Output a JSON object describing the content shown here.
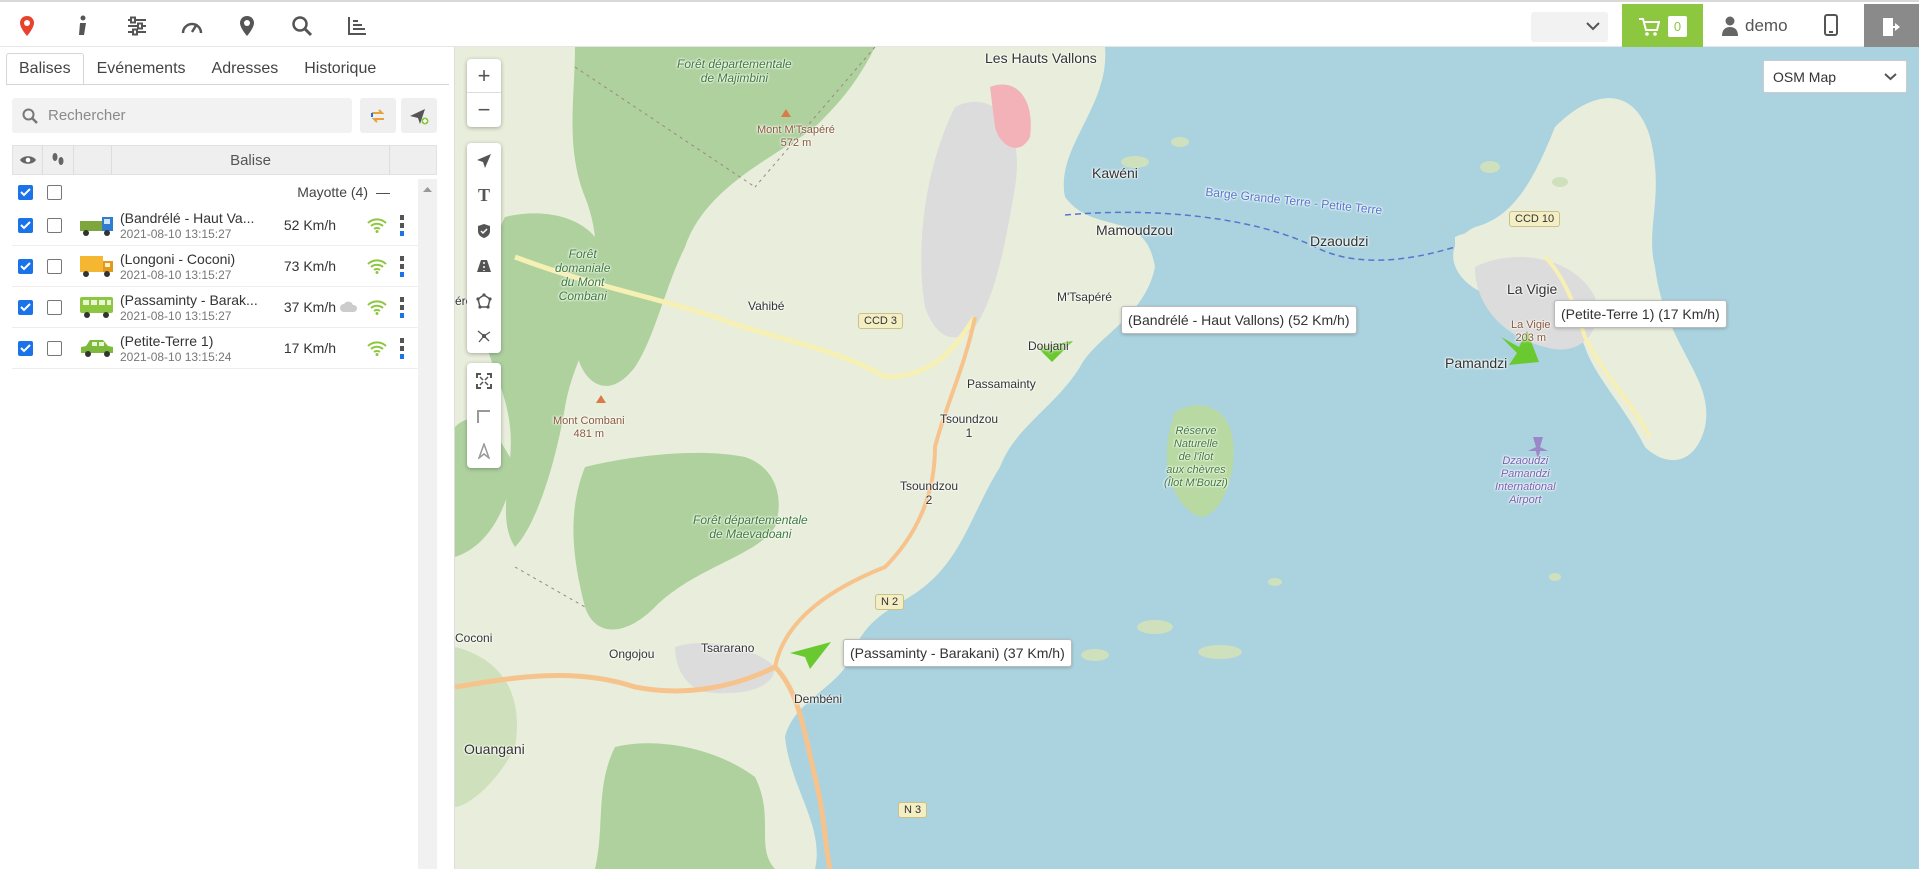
{
  "topbar": {
    "icons": [
      "map-pin-icon",
      "info-icon",
      "sliders-icon",
      "speedometer-icon",
      "location-marker-icon",
      "search-icon",
      "chart-icon"
    ],
    "cart_count": "0",
    "user_name": "demo"
  },
  "tabs": [
    {
      "label": "Balises",
      "active": true
    },
    {
      "label": "Evénements",
      "active": false
    },
    {
      "label": "Adresses",
      "active": false
    },
    {
      "label": "Historique",
      "active": false
    }
  ],
  "search": {
    "placeholder": "Rechercher"
  },
  "grid": {
    "column_balise": "Balise",
    "group": {
      "label": "Mayotte (4)",
      "collapse": "—"
    },
    "rows": [
      {
        "name": "(Bandrélé - Haut Va...",
        "time": "2021-08-10 13:15:27",
        "speed": "52 Km/h",
        "vehicle": "truck-blue",
        "checked": true
      },
      {
        "name": "(Longoni - Coconi)",
        "time": "2021-08-10 13:15:27",
        "speed": "73 Km/h",
        "vehicle": "truck-yellow",
        "checked": true
      },
      {
        "name": "(Passaminty - Barak...",
        "time": "2021-08-10 13:15:27",
        "speed": "37 Km/h",
        "vehicle": "bus-green",
        "checked": true
      },
      {
        "name": "(Petite-Terre 1)",
        "time": "2021-08-10 13:15:24",
        "speed": "17 Km/h",
        "vehicle": "car-green",
        "checked": true
      }
    ]
  },
  "map": {
    "layer": "OSM Map",
    "vehicle_labels": [
      "(Bandrélé - Haut Vallons) (52 Km/h)",
      "(Petite-Terre 1) (17 Km/h)",
      "(Passaminty - Barakani) (37 Km/h)"
    ],
    "places": {
      "haut_vallons": "Les Hauts Vallons",
      "kaweni": "Kawéni",
      "mamoudzou": "Mamoudzou",
      "mtsapere": "M'Tsapéré",
      "doujani": "Doujani",
      "passamainty": "Passamainty",
      "tsoundzou1": "Tsoundzou\n1",
      "tsoundzou2": "Tsoundzou\n2",
      "vahibe": "Vahibé",
      "dzaoudzi": "Dzaoudzi",
      "la_vigie": "La Vigie",
      "pamandzi": "Pamandzi",
      "ongojou": "Ongojou",
      "tsararano": "Tsararano",
      "dembeni": "Dembéni",
      "ouangani": "Ouangani",
      "coconi": "Coconi",
      "ereni": "éréni"
    },
    "forests": {
      "majimbini": "Forêt départementale\nde Majimbini",
      "mont_combani": "Forêt\ndomaniale\ndu Mont\nCombani",
      "maevadoani": "Forêt départementale\nde Maevadoani"
    },
    "peaks": {
      "mtsapere": "Mont M'Tsapéré\n572 m",
      "combani": "Mont Combani\n481 m",
      "la_vigie": "La Vigie\n203 m"
    },
    "ferry": "Barge Grande Terre - Petite Terre",
    "reserve": "Réserve\nNaturelle\nde l'îlot\naux chèvres\n(Îlot M'Bouzi)",
    "airport": "Dzaoudzi\nPamandzi\nInternational\nAirport",
    "roads": {
      "ccd3": "CCD 3",
      "ccd10": "CCD 10",
      "n2": "N 2",
      "n3": "N 3"
    }
  },
  "colors": {
    "accent": "#8dc63f",
    "checkbox": "#1a73e8",
    "land": "#e8eedb",
    "forest": "#aed19e",
    "sea": "#aad3df"
  }
}
